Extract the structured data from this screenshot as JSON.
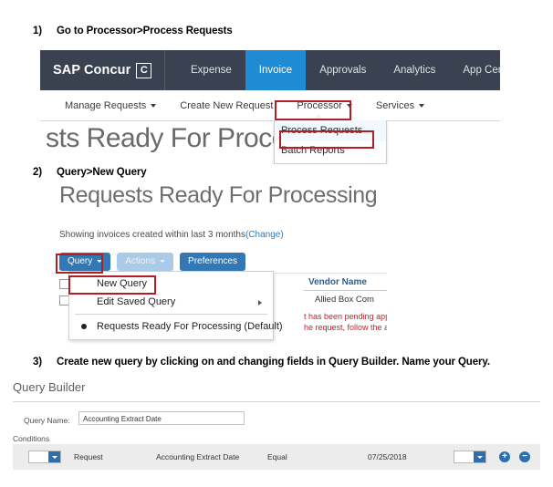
{
  "steps": [
    {
      "num": "1)",
      "text": "Go to Processor>Process Requests"
    },
    {
      "num": "2)",
      "text": "Query>New Query"
    },
    {
      "num": "3)",
      "text": "Create new query by clicking on and changing fields in Query Builder. Name your Query."
    }
  ],
  "shot1": {
    "brand": {
      "text": "SAP Concur",
      "mark": "C"
    },
    "tabs": [
      {
        "label": "Expense",
        "active": false
      },
      {
        "label": "Invoice",
        "active": true
      },
      {
        "label": "Approvals",
        "active": false
      },
      {
        "label": "Analytics",
        "active": false
      },
      {
        "label": "App Center",
        "active": false
      }
    ],
    "subnav": [
      {
        "label": "Manage Requests",
        "caret": true
      },
      {
        "label": "Create New Request",
        "caret": false
      },
      {
        "label": "Processor",
        "caret": true
      },
      {
        "label": "Services",
        "caret": true
      }
    ],
    "heading_clipped": "sts Ready For Process",
    "dropdown": {
      "items": [
        {
          "label": "Process Requests",
          "highlighted": true
        },
        {
          "label": "Batch Reports",
          "highlighted": false
        }
      ]
    },
    "active_tab_color": "#1f8bd4",
    "navbar_color": "#3a4150"
  },
  "shot2": {
    "title": "Requests Ready For Processing",
    "showing_text": "Showing invoices created within last 3 months",
    "showing_link": "(Change)",
    "buttons": [
      {
        "label": "Query",
        "caret": true,
        "disabled": false
      },
      {
        "label": "Actions",
        "caret": true,
        "disabled": true
      },
      {
        "label": "Preferences",
        "caret": false,
        "disabled": false
      }
    ],
    "query_menu": [
      {
        "label": "New Query",
        "submenu": false,
        "radio": false
      },
      {
        "label": "Edit Saved Query",
        "submenu": true,
        "radio": false
      },
      {
        "label": "Requests Ready For Processing (Default)",
        "submenu": false,
        "radio": true
      }
    ],
    "table": {
      "header": "Vendor Name",
      "cell": "Allied Box Com",
      "warning_line1": "t has been pending appro",
      "warning_line2": "he request, follow the app"
    },
    "button_color": "#3178b5",
    "link_color": "#2b7cc0",
    "warning_color": "#cc2026"
  },
  "shot3": {
    "title": "Query Builder",
    "query_name_label": "Query Name:",
    "query_name_value": "Accounting Extract Date",
    "conditions_label": "Conditions",
    "condition_row": {
      "left_select": "",
      "field_group": "Request",
      "field_name": "Accounting Extract Date",
      "operator": "Equal",
      "value": "07/25/2018",
      "right_select": "",
      "add_button": "+",
      "remove_button": "−"
    },
    "row_bg": "#ececec",
    "control_color": "#2e6fb0"
  },
  "annotation_color": "#b01f24"
}
